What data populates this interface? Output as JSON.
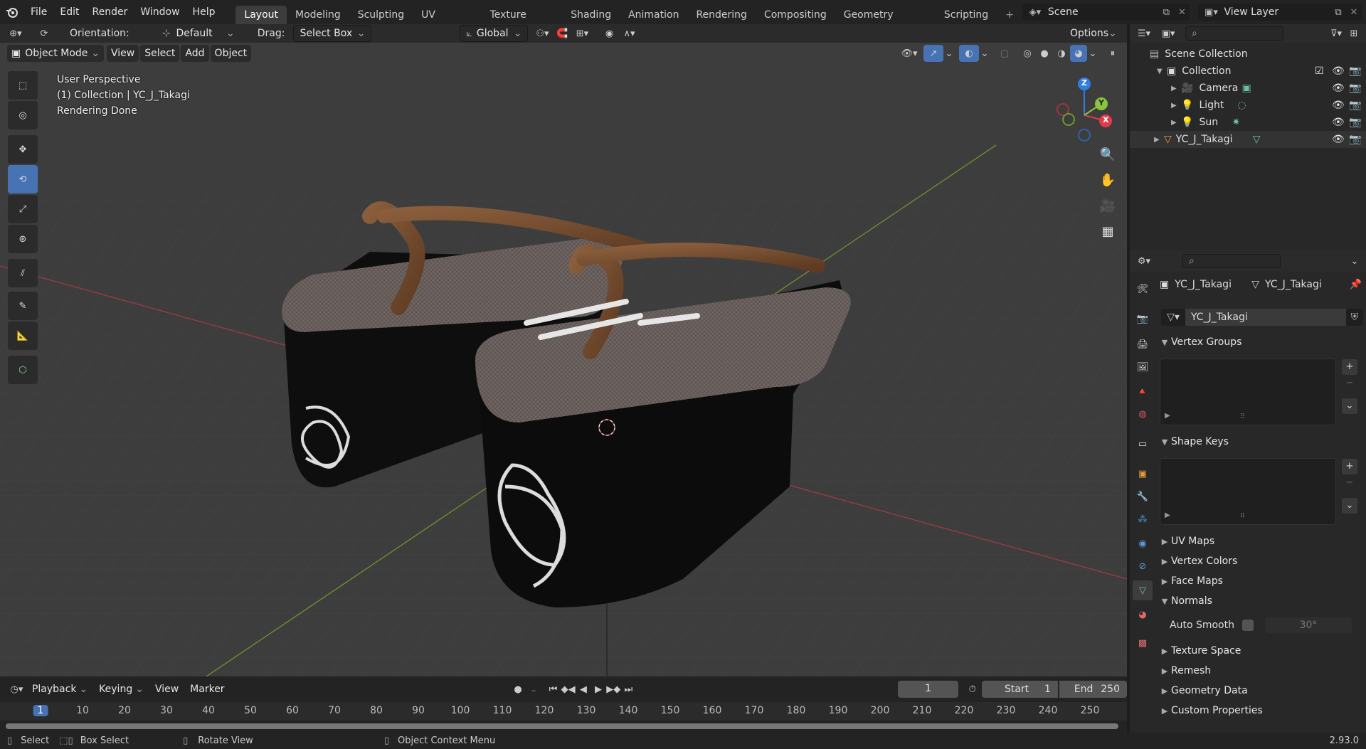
{
  "topbar": {
    "menus": [
      "File",
      "Edit",
      "Render",
      "Window",
      "Help"
    ],
    "workspaces": [
      "Layout",
      "Modeling",
      "Sculpting",
      "UV Editing",
      "Texture Paint",
      "Shading",
      "Animation",
      "Rendering",
      "Compositing",
      "Geometry Nodes",
      "Scripting"
    ],
    "add_tab": "+",
    "scene": "Scene",
    "view_layer": "View Layer"
  },
  "tool_header": {
    "orientation_label": "Orientation:",
    "orientation_value": "Default",
    "drag_label": "Drag:",
    "drag_value": "Select Box",
    "transform_orientation": "Global",
    "options": "Options"
  },
  "viewport_header": {
    "mode": "Object Mode",
    "menus": [
      "View",
      "Select",
      "Add",
      "Object"
    ]
  },
  "viewport_info": {
    "perspective": "User Perspective",
    "collection": "(1) Collection | YC_J_Takagi",
    "status": "Rendering Done"
  },
  "gizmo": {
    "x": "X",
    "y": "Y",
    "z": "Z"
  },
  "outliner": {
    "root": "Scene Collection",
    "items": [
      {
        "label": "Collection"
      },
      {
        "label": "Camera"
      },
      {
        "label": "Light"
      },
      {
        "label": "Sun"
      },
      {
        "label": "YC_J_Takagi"
      }
    ]
  },
  "properties": {
    "object_name": "YC_J_Takagi",
    "mesh_name": "YC_J_Takagi",
    "datablock": "YC_J_Takagi",
    "panels": {
      "vertex_groups": "Vertex Groups",
      "shape_keys": "Shape Keys",
      "uv_maps": "UV Maps",
      "vertex_colors": "Vertex Colors",
      "face_maps": "Face Maps",
      "normals": "Normals",
      "auto_smooth": "Auto Smooth",
      "auto_smooth_angle": "30°",
      "texture_space": "Texture Space",
      "remesh": "Remesh",
      "geometry_data": "Geometry Data",
      "custom_properties": "Custom Properties"
    }
  },
  "timeline": {
    "menus": [
      "Playback",
      "Keying",
      "View",
      "Marker"
    ],
    "current_frame": "1",
    "start_label": "Start",
    "start": "1",
    "end_label": "End",
    "end": "250",
    "ticks": [
      "1",
      "10",
      "20",
      "30",
      "40",
      "50",
      "60",
      "70",
      "80",
      "90",
      "100",
      "110",
      "120",
      "130",
      "140",
      "150",
      "160",
      "170",
      "180",
      "190",
      "200",
      "210",
      "220",
      "230",
      "240",
      "250"
    ]
  },
  "statusbar": {
    "select": "Select",
    "box_select": "Box Select",
    "rotate_view": "Rotate View",
    "context_menu": "Object Context Menu",
    "version": "2.93.0"
  },
  "colors": {
    "accent": "#4772b3",
    "axis_x": "#e13a4b",
    "axis_y": "#8bc53f",
    "axis_z": "#2f7fe0",
    "viewport_bg": "#3d3d3d"
  }
}
